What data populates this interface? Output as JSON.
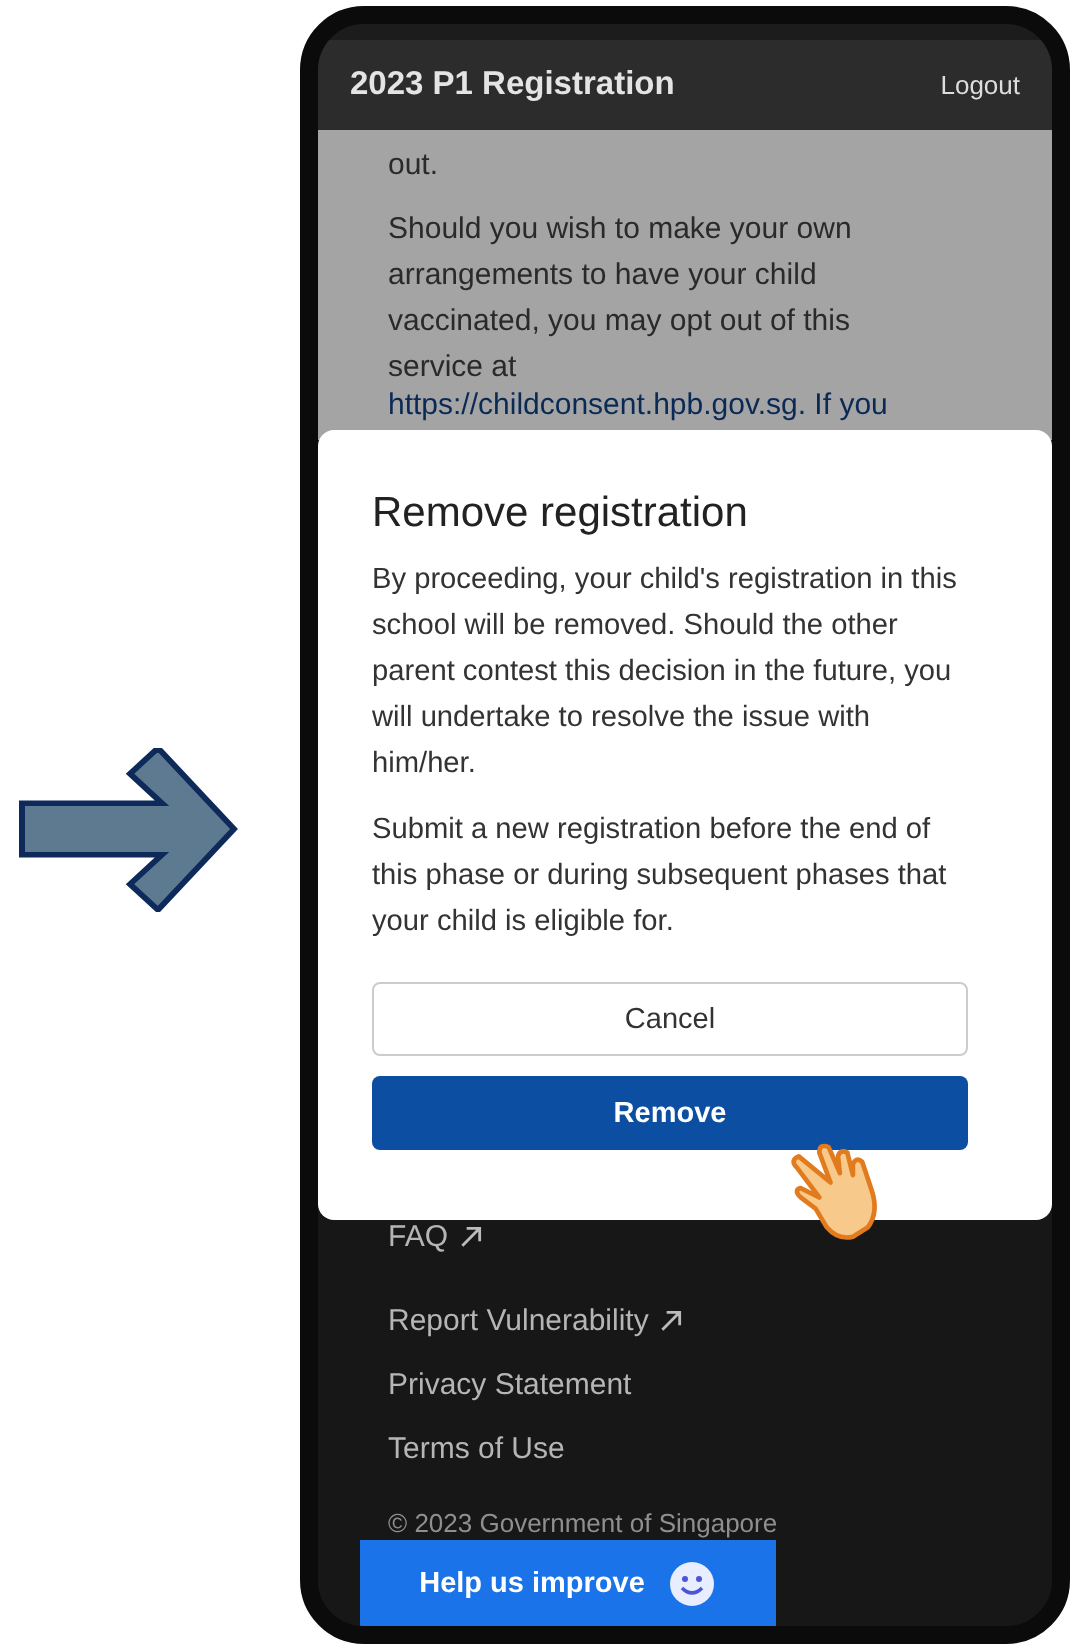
{
  "header": {
    "title": "2023 P1 Registration",
    "logout": "Logout"
  },
  "background_text": {
    "lead": "out.",
    "paragraph": "Should you wish to make your own arrangements to have your child vaccinated, you may opt out of this service at",
    "link": "https://childconsent.hpb.gov.sg. If you"
  },
  "dialog": {
    "title": "Remove registration",
    "paragraphs": [
      "By proceeding, your child's registration in this school will be removed. Should the other parent contest this decision in the future, you will undertake to resolve the issue with him/her.",
      "Submit a new registration before the end of this phase or during subsequent phases that your child is eligible for."
    ],
    "buttons": [
      {
        "label": "Cancel",
        "kind": "secondary"
      },
      {
        "label": "Remove",
        "kind": "primary"
      }
    ]
  },
  "footer": {
    "links": [
      {
        "label": "FAQ",
        "external": true
      },
      {
        "label": "Report Vulnerability",
        "external": true
      },
      {
        "label": "Privacy Statement",
        "external": false
      },
      {
        "label": "Terms of Use",
        "external": false
      }
    ],
    "copyright": "© 2023 Government of Singapore"
  },
  "feedback_button": {
    "label": "Help us improve"
  }
}
